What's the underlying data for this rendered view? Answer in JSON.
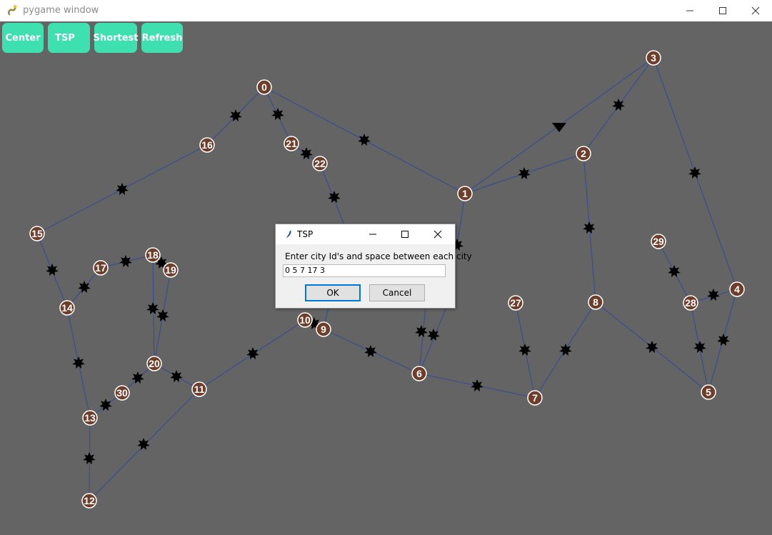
{
  "window": {
    "title": "pygame window",
    "controls": [
      "minimize",
      "maximize",
      "close"
    ]
  },
  "toolbar": {
    "buttons": [
      {
        "label": "Center"
      },
      {
        "label": "TSP"
      },
      {
        "label": "Shortest"
      },
      {
        "label": "Refresh"
      }
    ],
    "color": "#3ee0b0"
  },
  "graph": {
    "node_fill": "#6e3e2a",
    "edge_color": "#3a4d8f",
    "nodes": [
      {
        "id": "0"
      },
      {
        "id": "1"
      },
      {
        "id": "2"
      },
      {
        "id": "3"
      },
      {
        "id": "4"
      },
      {
        "id": "5"
      },
      {
        "id": "6"
      },
      {
        "id": "7"
      },
      {
        "id": "8"
      },
      {
        "id": "9"
      },
      {
        "id": "10"
      },
      {
        "id": "11"
      },
      {
        "id": "12"
      },
      {
        "id": "13"
      },
      {
        "id": "14"
      },
      {
        "id": "15"
      },
      {
        "id": "16"
      },
      {
        "id": "17"
      },
      {
        "id": "18"
      },
      {
        "id": "19"
      },
      {
        "id": "20"
      },
      {
        "id": "21"
      },
      {
        "id": "22"
      },
      {
        "id": "27"
      },
      {
        "id": "28"
      },
      {
        "id": "29"
      },
      {
        "id": "30"
      }
    ]
  },
  "dialog": {
    "title": "TSP",
    "prompt": "Enter city Id's and space between each city",
    "input_value": "0 5 7 17 3",
    "ok_label": "OK",
    "cancel_label": "Cancel"
  }
}
